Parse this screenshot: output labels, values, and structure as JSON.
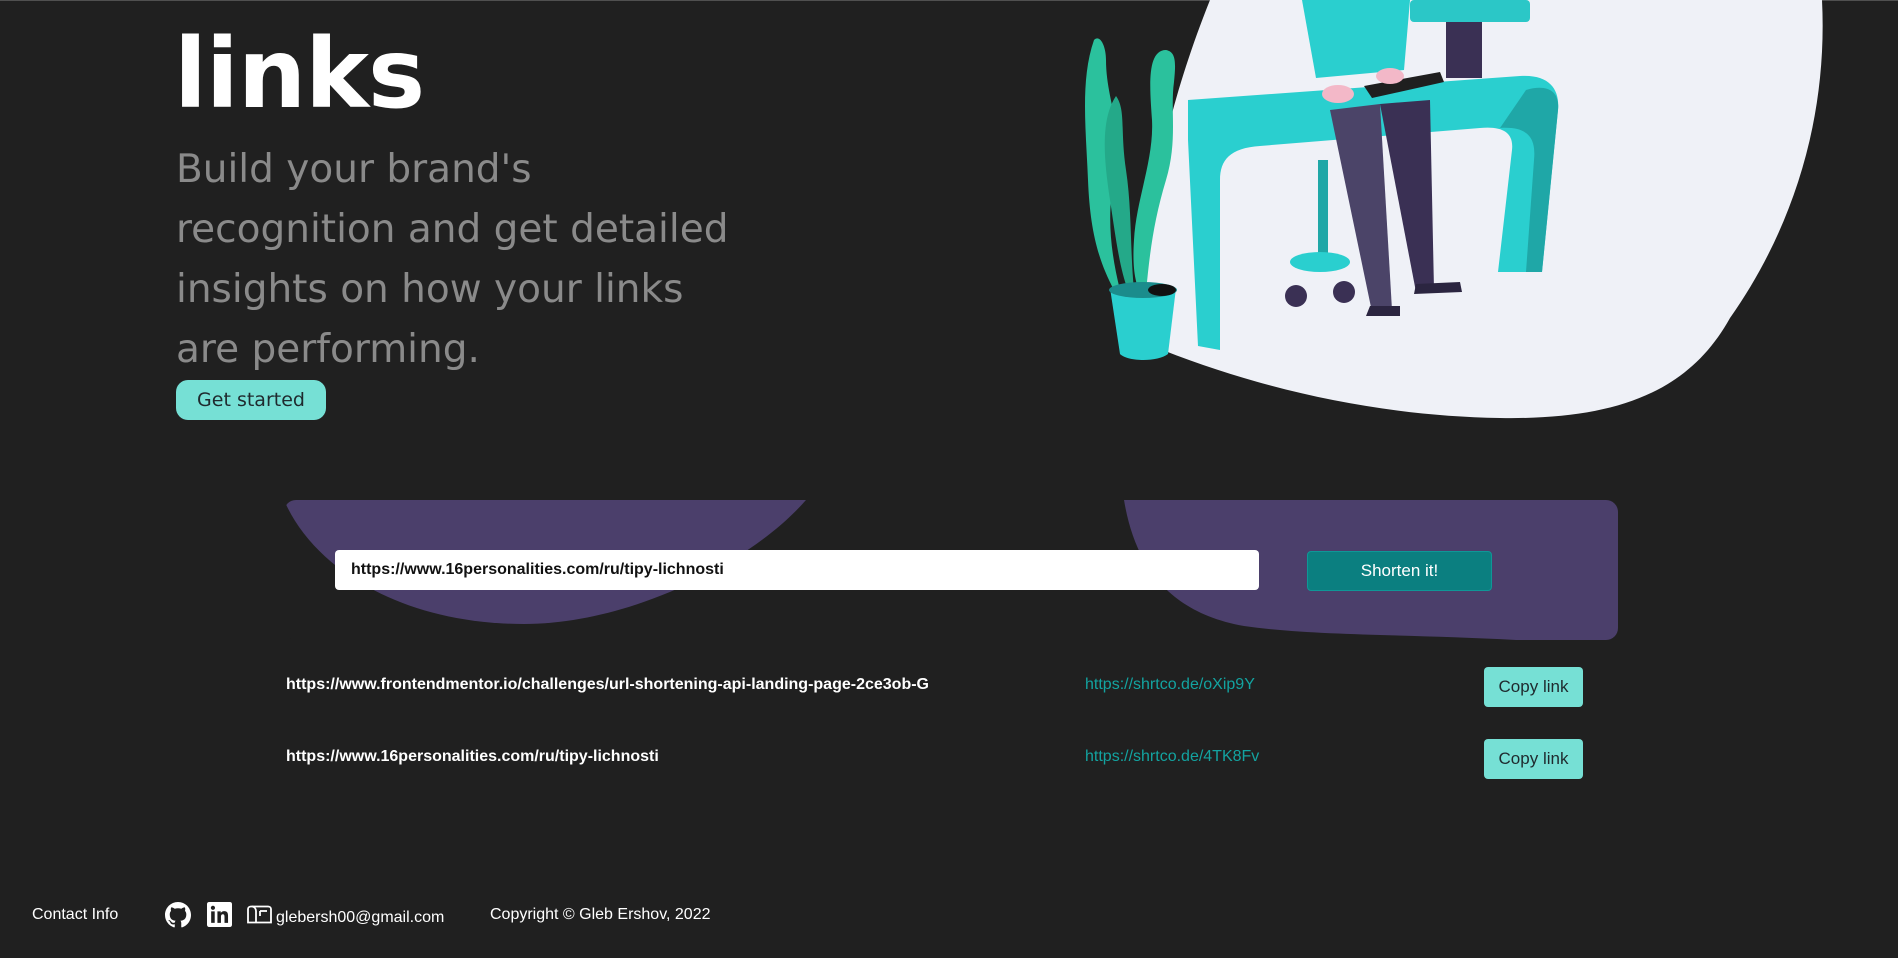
{
  "hero": {
    "title": "links",
    "subtitle": "Build your brand's recognition and get detailed insights on how your links are performing.",
    "cta_label": "Get started"
  },
  "shortener": {
    "input_value": "https://www.16personalities.com/ru/tipy-lichnosti",
    "button_label": "Shorten it!"
  },
  "results": [
    {
      "original": "https://www.frontendmentor.io/challenges/url-shortening-api-landing-page-2ce3ob-G",
      "short": "https://shrtco.de/oXip9Y",
      "copy_label": "Copy link"
    },
    {
      "original": "https://www.16personalities.com/ru/tipy-lichnosti",
      "short": "https://shrtco.de/4TK8Fv",
      "copy_label": "Copy link"
    }
  ],
  "footer": {
    "contact_label": "Contact Info",
    "email": "glebersh00@gmail.com",
    "copyright": "Copyright © Gleb Ershov, 2022"
  },
  "icons": [
    "github-icon",
    "linkedin-icon",
    "mail-icon"
  ],
  "colors": {
    "background": "#202020",
    "accent": "#76e0d5",
    "primary_button": "#0b7f80",
    "short_link": "#13a3a0",
    "panel": "#4b3f6b",
    "muted_text": "#8a8a8a"
  }
}
